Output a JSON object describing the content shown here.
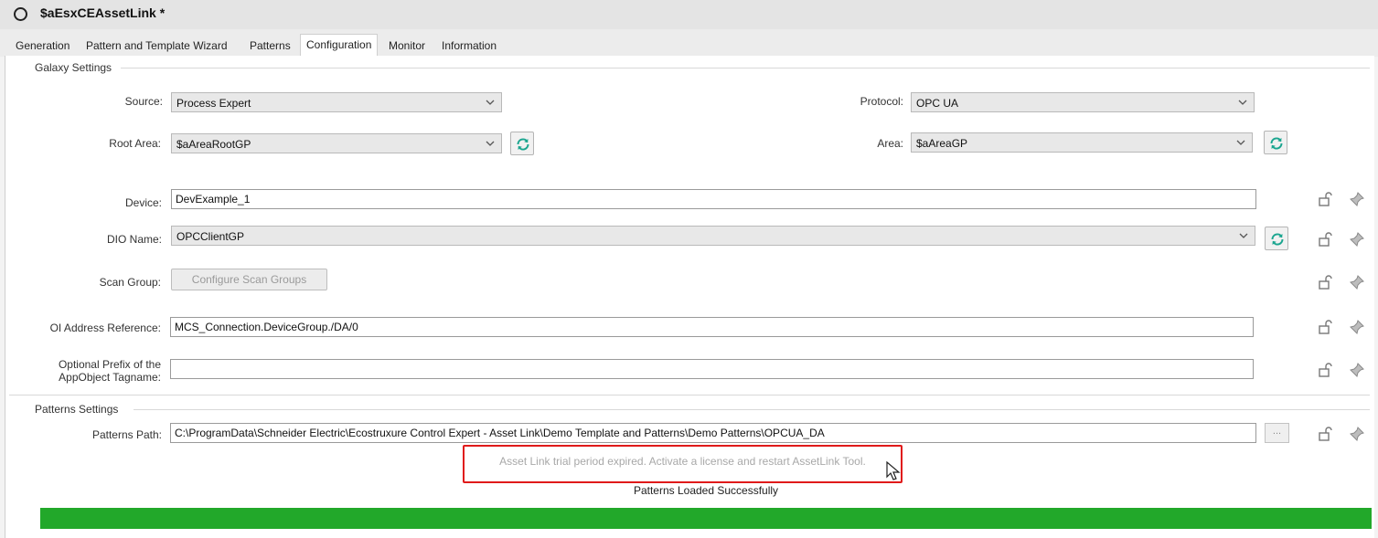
{
  "window": {
    "title": "$aEsxCEAssetLink *"
  },
  "tabs": [
    {
      "label": "Generation"
    },
    {
      "label": "Pattern and Template Wizard"
    },
    {
      "label": "Patterns"
    },
    {
      "label": "Configuration"
    },
    {
      "label": "Monitor"
    },
    {
      "label": "Information"
    }
  ],
  "active_tab": "Configuration",
  "galaxy": {
    "section_title": "Galaxy Settings",
    "source": {
      "label": "Source:",
      "value": "Process Expert"
    },
    "protocol": {
      "label": "Protocol:",
      "value": "OPC UA"
    },
    "root_area": {
      "label": "Root Area:",
      "value": "$aAreaRootGP"
    },
    "area": {
      "label": "Area:",
      "value": "$aAreaGP"
    },
    "device": {
      "label": "Device:",
      "value": "DevExample_1"
    },
    "dio_name": {
      "label": "DIO Name:",
      "value": "OPCClientGP"
    },
    "scan_group": {
      "label": "Scan Group:",
      "button": "Configure Scan Groups"
    },
    "oi_address": {
      "label": "OI Address Reference:",
      "value": "MCS_Connection.DeviceGroup./DA/0"
    },
    "prefix": {
      "label": "Optional Prefix of the AppObject Tagname:",
      "value": ""
    }
  },
  "patterns": {
    "section_title": "Patterns Settings",
    "path": {
      "label": "Patterns Path:",
      "value": "C:\\ProgramData\\Schneider Electric\\Ecostruxure Control Expert - Asset Link\\Demo Template and Patterns\\Demo Patterns\\OPCUA_DA",
      "browse": "..."
    }
  },
  "message": "Asset Link trial period expired. Activate a license and restart AssetLink Tool.",
  "status": "Patterns Loaded Successfully",
  "progress": 1.0,
  "colors": {
    "progress": "#22a82a",
    "highlight": "#e01a1a",
    "refresh": "#1aa58f"
  }
}
